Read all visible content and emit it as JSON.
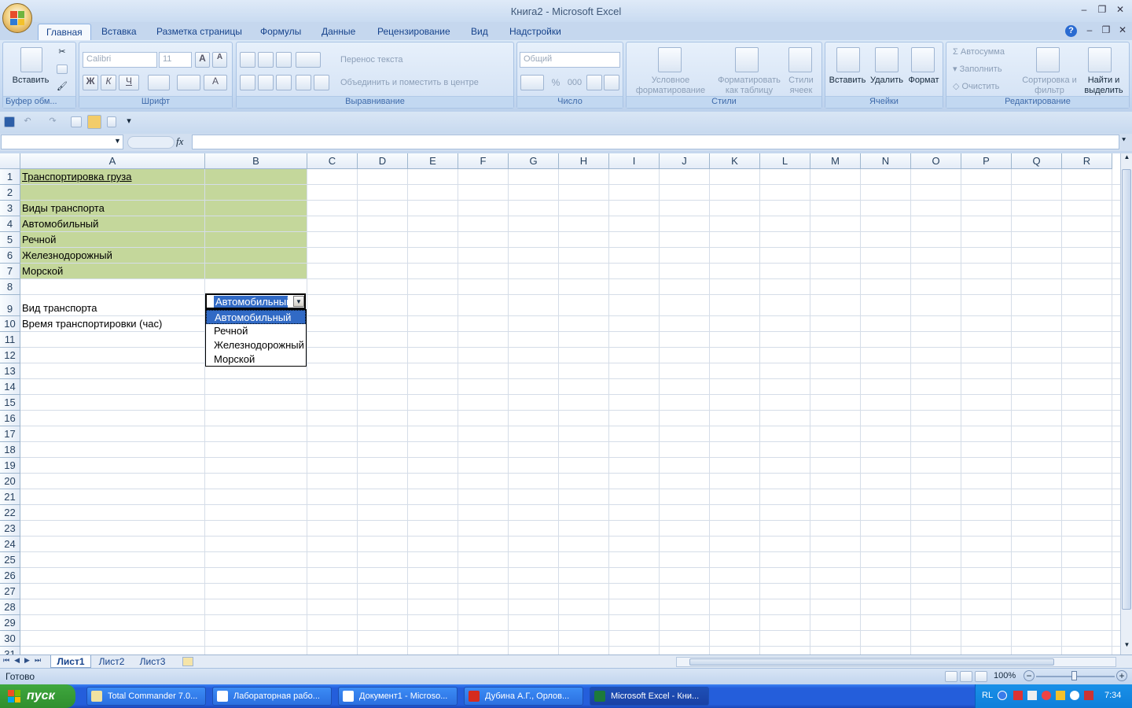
{
  "window": {
    "title": "Книга2 - Microsoft Excel"
  },
  "tabs": [
    "Главная",
    "Вставка",
    "Разметка страницы",
    "Формулы",
    "Данные",
    "Рецензирование",
    "Вид",
    "Надстройки"
  ],
  "ribbon": {
    "clipboard": {
      "paste": "Вставить",
      "label": "Буфер обм..."
    },
    "font": {
      "name": "Calibri",
      "size": "11",
      "bold": "Ж",
      "italic": "К",
      "underline": "Ч",
      "grow": "A",
      "shrink": "A",
      "color": "A",
      "label": "Шрифт"
    },
    "alignment": {
      "wrap": "Перенос текста",
      "merge": "Объединить и поместить в центре",
      "label": "Выравнивание"
    },
    "number": {
      "format": "Общий",
      "percent": "%",
      "thousands": "000",
      "label": "Число"
    },
    "styles": {
      "conditional": "Условное форматирование",
      "table": "Форматировать как таблицу",
      "cell": "Стили ячеек",
      "label": "Стили"
    },
    "cells": {
      "insert": "Вставить",
      "delete": "Удалить",
      "format": "Формат",
      "label": "Ячейки"
    },
    "editing": {
      "autosum": "Автосумма",
      "fill": "Заполнить",
      "clear": "Очистить",
      "sort": "Сортировка и фильтр",
      "find": "Найти и выделить",
      "label": "Редактирование"
    }
  },
  "formula_bar": {
    "name_box": "",
    "fx": "fx",
    "value": ""
  },
  "columns": [
    "A",
    "B",
    "C",
    "D",
    "E",
    "F",
    "G",
    "H",
    "I",
    "J",
    "K",
    "L",
    "M",
    "N",
    "O",
    "P",
    "Q",
    "R"
  ],
  "rows": [
    "1",
    "2",
    "3",
    "4",
    "5",
    "6",
    "7",
    "8",
    "9",
    "10",
    "11",
    "12",
    "13",
    "14",
    "15",
    "16",
    "17",
    "18",
    "19",
    "20",
    "21",
    "22",
    "23",
    "24",
    "25",
    "26",
    "27",
    "28",
    "29",
    "30",
    "31"
  ],
  "cells": {
    "A1": "Транспортировка груза",
    "A3": "Виды транспорта",
    "A4": "Автомобильный",
    "A5": "Речной",
    "A6": "Железнодорожный",
    "A7": "Морской",
    "A9": "Вид транспорта",
    "A10": "Время транспортировки (час)",
    "B9": "Автомобильный"
  },
  "dropdown": {
    "options": [
      "Автомобильный",
      "Речной",
      "Железнодорожный",
      "Морской"
    ],
    "selected": "Автомобильный"
  },
  "sheets": [
    "Лист1",
    "Лист2",
    "Лист3"
  ],
  "active_sheet": "Лист1",
  "status": {
    "ready": "Готово",
    "zoom": "100%"
  },
  "taskbar": {
    "start": "пуск",
    "items": [
      "Total Commander 7.0...",
      "Лабораторная рабо...",
      "Документ1 - Microso...",
      "Дубина А.Г., Орлов...",
      "Microsoft Excel - Кни..."
    ],
    "lang": "RL",
    "clock": "7:34"
  },
  "colors": {
    "green_fill": "#c4d79b",
    "selection": "#316ac5",
    "ribbon": "#dbe8f7"
  }
}
